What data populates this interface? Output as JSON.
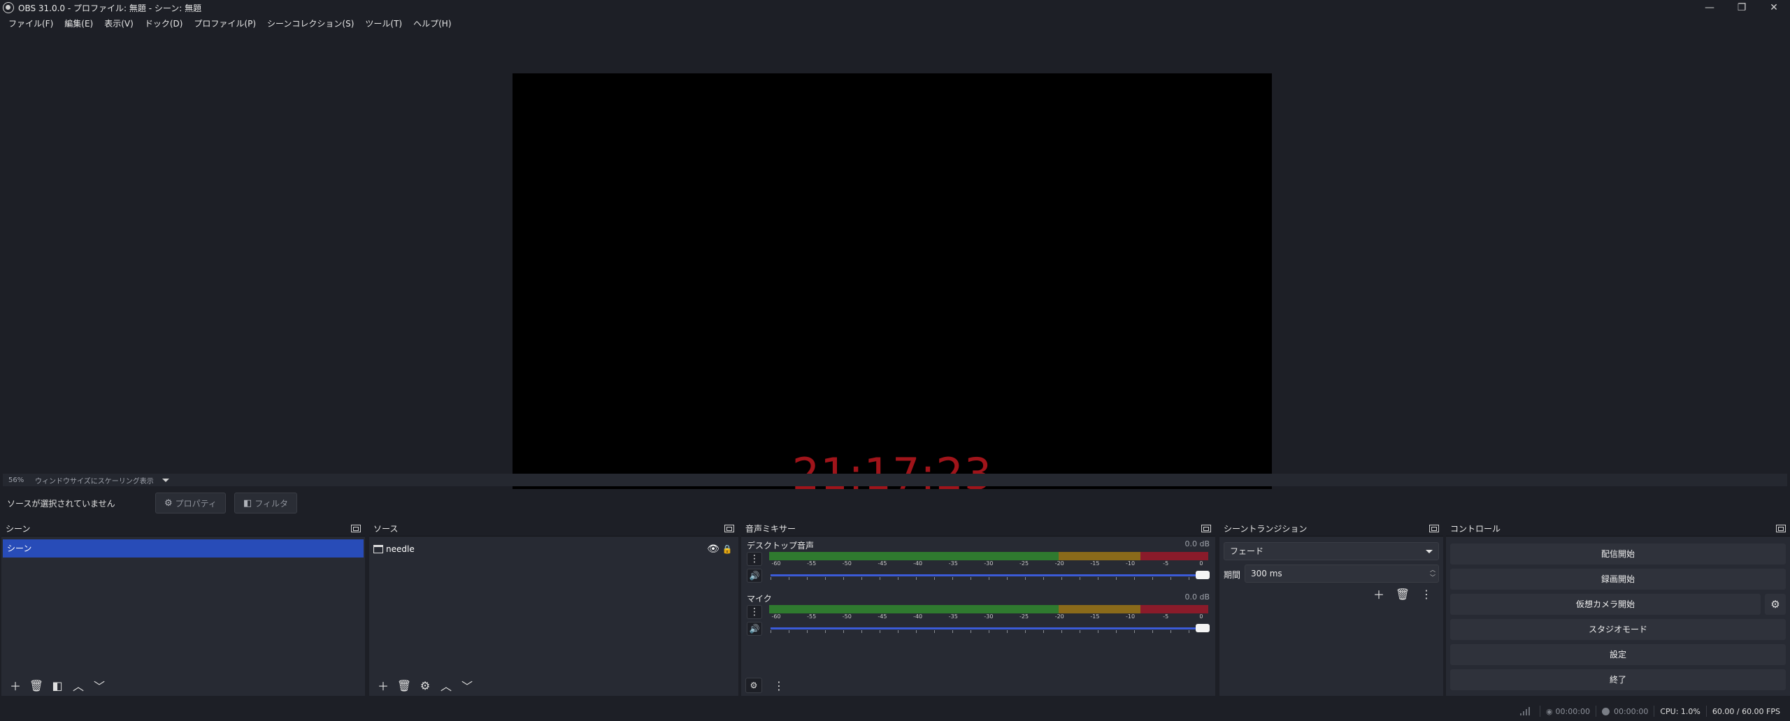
{
  "window": {
    "title": "OBS 31.0.0 - プロファイル: 無題 - シーン: 無題",
    "minimize_icon": "—",
    "maximize_icon": "❐",
    "close_icon": "✕"
  },
  "menu": [
    "ファイル(F)",
    "編集(E)",
    "表示(V)",
    "ドック(D)",
    "プロファイル(P)",
    "シーンコレクション(S)",
    "ツール(T)",
    "ヘルプ(H)"
  ],
  "preview": {
    "clock_text": "21:17:23",
    "clock_color": "#a0141a",
    "zoom": "56%",
    "scale_mode": "ウィンドウサイズにスケーリング表示"
  },
  "context_bar": {
    "no_source_text": "ソースが選択されていません",
    "properties_label": "プロパティ",
    "filters_label": "フィルタ"
  },
  "scenes": {
    "title": "シーン",
    "items": [
      "シーン"
    ],
    "selected_color": "#284cb8"
  },
  "sources": {
    "title": "ソース",
    "items": [
      {
        "name": "needle"
      }
    ]
  },
  "mixer": {
    "title": "音声ミキサー",
    "channels": [
      {
        "name": "デスクトップ音声",
        "db": "0.0 dB"
      },
      {
        "name": "マイク",
        "db": "0.0 dB"
      }
    ],
    "ticks": [
      "-60",
      "-55",
      "-50",
      "-45",
      "-40",
      "-35",
      "-30",
      "-25",
      "-20",
      "-15",
      "-10",
      "-5",
      "0"
    ]
  },
  "transitions": {
    "title": "シーントランジション",
    "selected": "フェード",
    "duration_label": "期間",
    "duration_value": "300 ms"
  },
  "controls": {
    "title": "コントロール",
    "buttons": [
      "配信開始",
      "録画開始",
      "仮想カメラ開始",
      "スタジオモード",
      "設定",
      "終了"
    ]
  },
  "status": {
    "stream_time": "00:00:00",
    "rec_time": "00:00:00",
    "cpu": "CPU: 1.0%",
    "fps": "60.00 / 60.00 FPS"
  }
}
